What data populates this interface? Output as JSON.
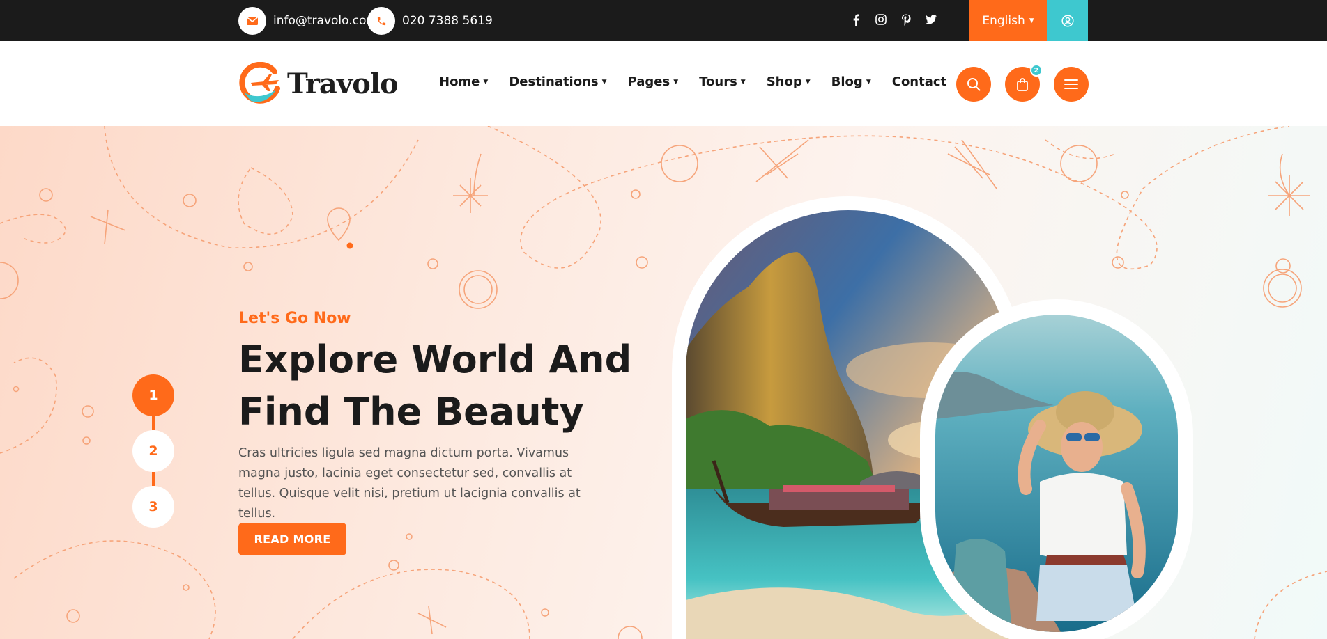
{
  "topbar": {
    "email": "info@travolo.com",
    "phone": "020 7388 5619",
    "social_icons": [
      "facebook-icon",
      "instagram-icon",
      "pinterest-icon",
      "twitter-icon"
    ],
    "language": "English",
    "colors": {
      "bar": "#1b1b1b",
      "accent": "#ff6a1a",
      "teal": "#3ec8cf"
    }
  },
  "header": {
    "logo_text": "Travolo",
    "nav": [
      {
        "label": "Home",
        "dropdown": true
      },
      {
        "label": "Destinations",
        "dropdown": true
      },
      {
        "label": "Pages",
        "dropdown": true
      },
      {
        "label": "Tours",
        "dropdown": true
      },
      {
        "label": "Shop",
        "dropdown": true
      },
      {
        "label": "Blog",
        "dropdown": true
      },
      {
        "label": "Contact",
        "dropdown": false
      }
    ],
    "cart_count": "2",
    "icons": [
      "search-icon",
      "shopping-bag-icon",
      "menu-icon"
    ]
  },
  "hero": {
    "kicker": "Let's Go Now",
    "headline_line1": "Explore World And",
    "headline_line2": "Find The Beauty",
    "paragraph": "Cras ultricies ligula sed magna dictum porta. Vivamus magna justo, lacinia eget consectetur sed, convallis at tellus. Quisque velit nisi, pretium ut lacignia convallis at tellus.",
    "button": "READ MORE",
    "steps": [
      "1",
      "2",
      "3"
    ],
    "active_step": "1"
  }
}
